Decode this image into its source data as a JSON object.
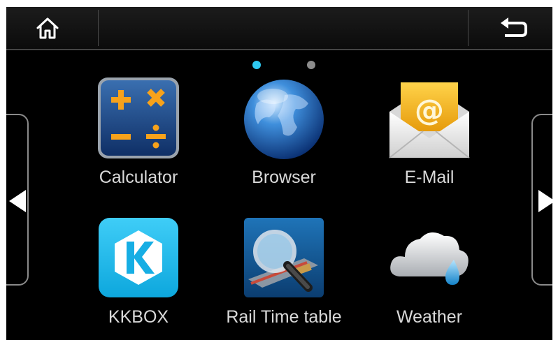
{
  "pagination": {
    "active_color": "#2ec8f0",
    "inactive_color": "#8c8c8c"
  },
  "apps": [
    {
      "label": "Calculator",
      "icon": "calculator-icon"
    },
    {
      "label": "Browser",
      "icon": "globe-icon"
    },
    {
      "label": "E-Mail",
      "icon": "envelope-icon"
    },
    {
      "label": "KKBOX",
      "icon": "kkbox-icon"
    },
    {
      "label": "Rail Time table",
      "icon": "rail-timetable-icon"
    },
    {
      "label": "Weather",
      "icon": "cloud-rain-icon"
    }
  ],
  "icons": {
    "home": "home-icon",
    "back": "back-arrow-icon",
    "prev": "left-arrow-icon",
    "next": "right-arrow-icon"
  }
}
